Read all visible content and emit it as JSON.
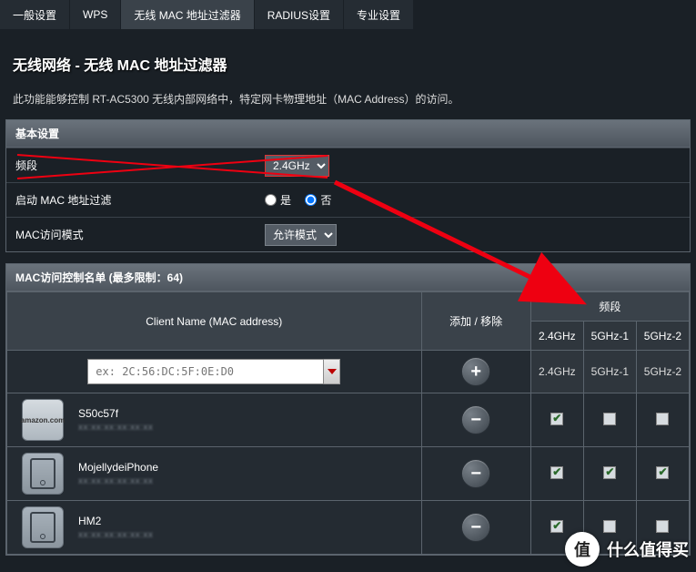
{
  "tabs": [
    {
      "label": "一般设置",
      "active": false
    },
    {
      "label": "WPS",
      "active": false
    },
    {
      "label": "无线 MAC 地址过滤器",
      "active": true
    },
    {
      "label": "RADIUS设置",
      "active": false
    },
    {
      "label": "专业设置",
      "active": false
    }
  ],
  "title": "无线网络 - 无线 MAC 地址过滤器",
  "desc": "此功能能够控制 RT-AC5300 无线内部网络中，特定网卡物理地址（MAC Address）的访问。",
  "basic": {
    "header": "基本设置",
    "band_label": "频段",
    "band_value": "2.4GHz",
    "enable_label": "启动 MAC 地址过滤",
    "yes": "是",
    "no": "否",
    "enable_value": "no",
    "mode_label": "MAC访问模式",
    "mode_value": "允许模式"
  },
  "list": {
    "header": "MAC访问控制名单 (最多限制：64)",
    "col_client": "Client Name (MAC address)",
    "col_addrem": "添加 / 移除",
    "col_band": "频段",
    "band_cols": [
      "2.4GHz",
      "5GHz-1",
      "5GHz-2"
    ],
    "input_placeholder": "ex: 2C:56:DC:5F:0E:D0",
    "rows": [
      {
        "icon": "amazon",
        "name": "S50c57f",
        "mac": "xx:xx:xx:xx:xx:xx",
        "checks": [
          true,
          false,
          false
        ]
      },
      {
        "icon": "tablet",
        "name": "MojellydeiPhone",
        "mac": "xx:xx:xx:xx:xx:xx",
        "checks": [
          true,
          true,
          true
        ]
      },
      {
        "icon": "tablet",
        "name": "HM2",
        "mac": "xx:xx:xx:xx:xx:xx",
        "checks": [
          true,
          false,
          false
        ]
      }
    ]
  },
  "watermark": {
    "badge": "值",
    "text": "什么值得买"
  }
}
